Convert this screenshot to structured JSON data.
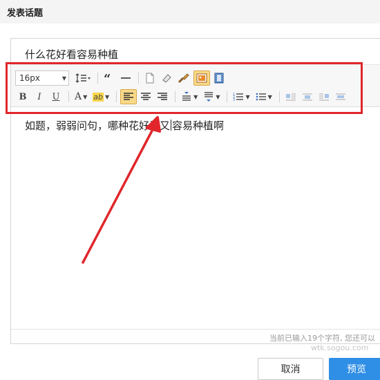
{
  "header": {
    "title": "发表话题"
  },
  "title_input": {
    "value": "什么花好看容易种植"
  },
  "toolbar": {
    "font_size": "16px",
    "icons_row1": [
      "line-height-icon",
      "quote-icon",
      "horizontal-rule-icon",
      "page-icon",
      "eraser-icon",
      "format-brush-icon",
      "image-icon",
      "video-icon"
    ],
    "icons_row2": [
      "bold-icon",
      "italic-icon",
      "underline-icon",
      "font-color-icon",
      "background-color-icon",
      "align-left-icon",
      "align-center-icon",
      "align-right-icon",
      "spacing-top-icon",
      "spacing-bottom-icon",
      "ordered-list-icon",
      "unordered-list-icon",
      "image-left-icon",
      "image-center-icon",
      "image-right-icon",
      "image-none-icon"
    ],
    "bold": "B",
    "italic": "I",
    "underline": "U",
    "font_color": "A",
    "bg_color": "ab",
    "active_button": "align-left"
  },
  "content": {
    "text_before_cursor": "如题，弱弱问句，哪种花好看又",
    "text_after_cursor": "容易种植啊"
  },
  "counter": {
    "text": "当前已输入19个字符, 您还可以"
  },
  "buttons": {
    "cancel": "取消",
    "preview": "预览"
  },
  "watermark": "wtk.sogou.com",
  "colors": {
    "highlight": "#e0262b",
    "primary": "#2f8ee6",
    "active_bg": "#f8d988"
  }
}
